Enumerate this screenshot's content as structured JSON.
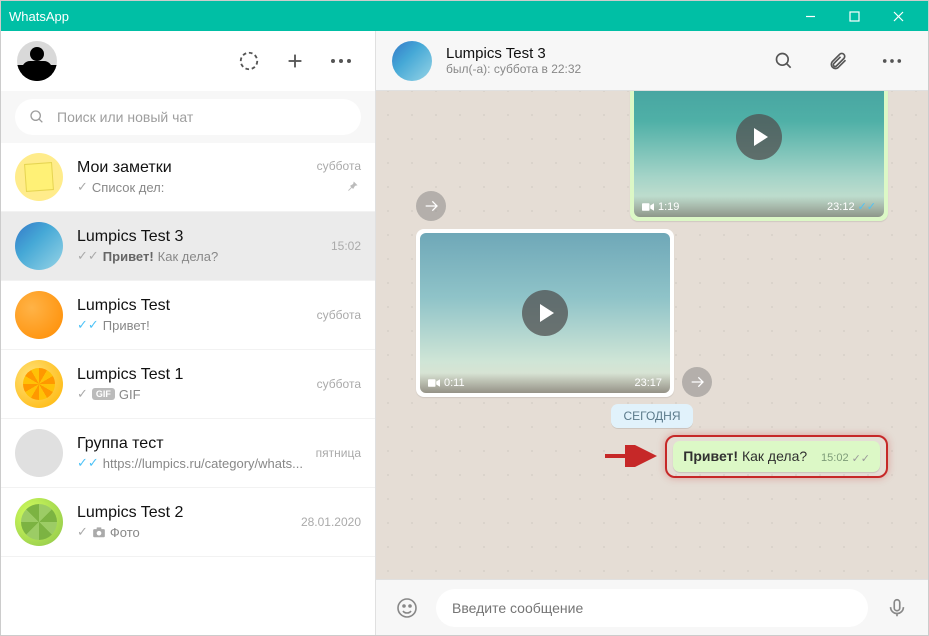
{
  "window": {
    "title": "WhatsApp"
  },
  "left": {
    "search_placeholder": "Поиск или новый чат",
    "chats": [
      {
        "name": "Мои заметки",
        "time": "суббота",
        "preview_prefix": "",
        "preview_bold": "",
        "preview": "Список дел:",
        "check": "grey",
        "pinned": true,
        "active": false,
        "av": "av-notes"
      },
      {
        "name": "Lumpics Test 3",
        "time": "15:02",
        "preview_bold": "Привет! ",
        "preview": "Как дела?",
        "check": "grey-double",
        "active": true,
        "av": "av-lumpics3"
      },
      {
        "name": "Lumpics Test",
        "time": "суббота",
        "preview_bold": "",
        "preview": "Привет!",
        "check": "blue",
        "active": false,
        "av": "av-orange"
      },
      {
        "name": "Lumpics Test 1",
        "time": "суббота",
        "preview_bold": "",
        "preview": "GIF",
        "check": "grey-single",
        "gif": true,
        "active": false,
        "av": "av-orange2"
      },
      {
        "name": "Группа тест",
        "time": "пятница",
        "preview_bold": "",
        "preview": "https://lumpics.ru/category/whats...",
        "check": "blue",
        "active": false,
        "av": "av-group"
      },
      {
        "name": "Lumpics Test 2",
        "time": "28.01.2020",
        "preview_bold": "",
        "preview": "Фото",
        "check": "grey-single",
        "photo": true,
        "active": false,
        "av": "av-lime"
      }
    ]
  },
  "right": {
    "contact_name": "Lumpics Test 3",
    "contact_status": "был(-а): суббота в 22:32",
    "day_label": "СЕГОДНЯ",
    "video1": {
      "duration": "1:19",
      "time": "23:12"
    },
    "video2": {
      "duration": "0:11",
      "time": "23:17"
    },
    "msg": {
      "bold": "Привет!",
      "rest": " Как дела?",
      "time": "15:02"
    },
    "composer_placeholder": "Введите сообщение"
  }
}
